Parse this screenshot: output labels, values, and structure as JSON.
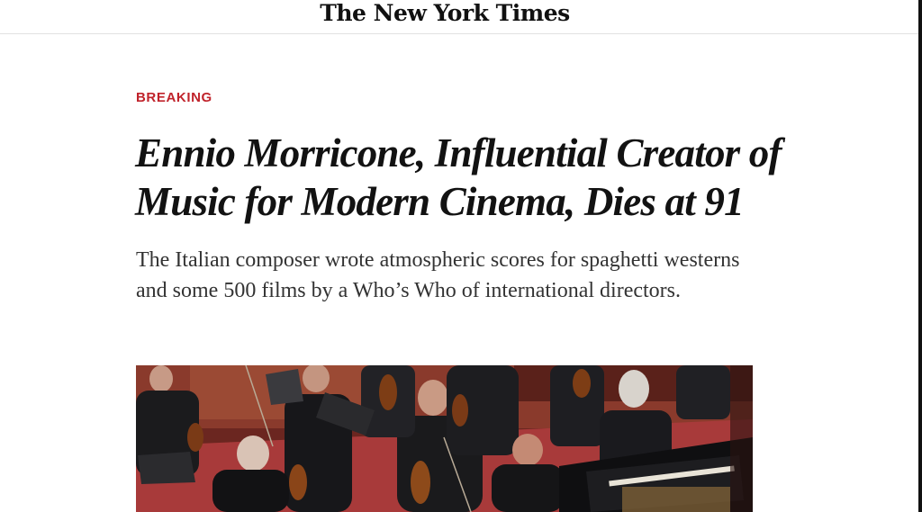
{
  "masthead": {
    "logo_text": "The New York Times"
  },
  "article": {
    "kicker": "BREAKING",
    "headline": "Ennio Morricone, Influential Creator of Music for Modern Cinema, Dies at 91",
    "summary": "The Italian composer wrote atmospheric scores for spaghetti westerns and some 500 films by a Who’s Who of international directors."
  },
  "colors": {
    "kicker": "#c0232b",
    "text": "#121212",
    "summary": "#333333",
    "photo_floor": "#a83a3a"
  },
  "icons": [
    "nyt-logo"
  ]
}
